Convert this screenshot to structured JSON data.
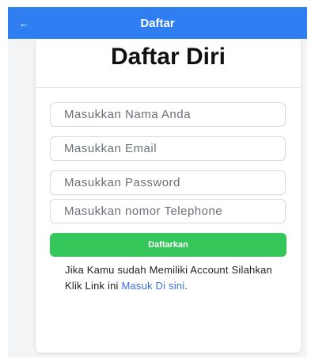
{
  "appbar": {
    "back_icon": "←",
    "title": "Daftar"
  },
  "card": {
    "title": "Daftar Diri"
  },
  "form": {
    "name_placeholder": "Masukkan Nama Anda",
    "email_placeholder": "Masukkan Email",
    "password_placeholder": "Masukkan Password",
    "phone_placeholder": "Masukkan nomor Telephone",
    "submit_label": "Daftarkan"
  },
  "login_note": {
    "text": "Jika Kamu sudah Memiliki Account Silahkan Klik Link ini ",
    "link_text": "Masuk Di sini",
    "suffix": "."
  },
  "colors": {
    "appbar": "#2f7ff2",
    "submit_button": "#35c759",
    "link": "#3b6fe0"
  }
}
